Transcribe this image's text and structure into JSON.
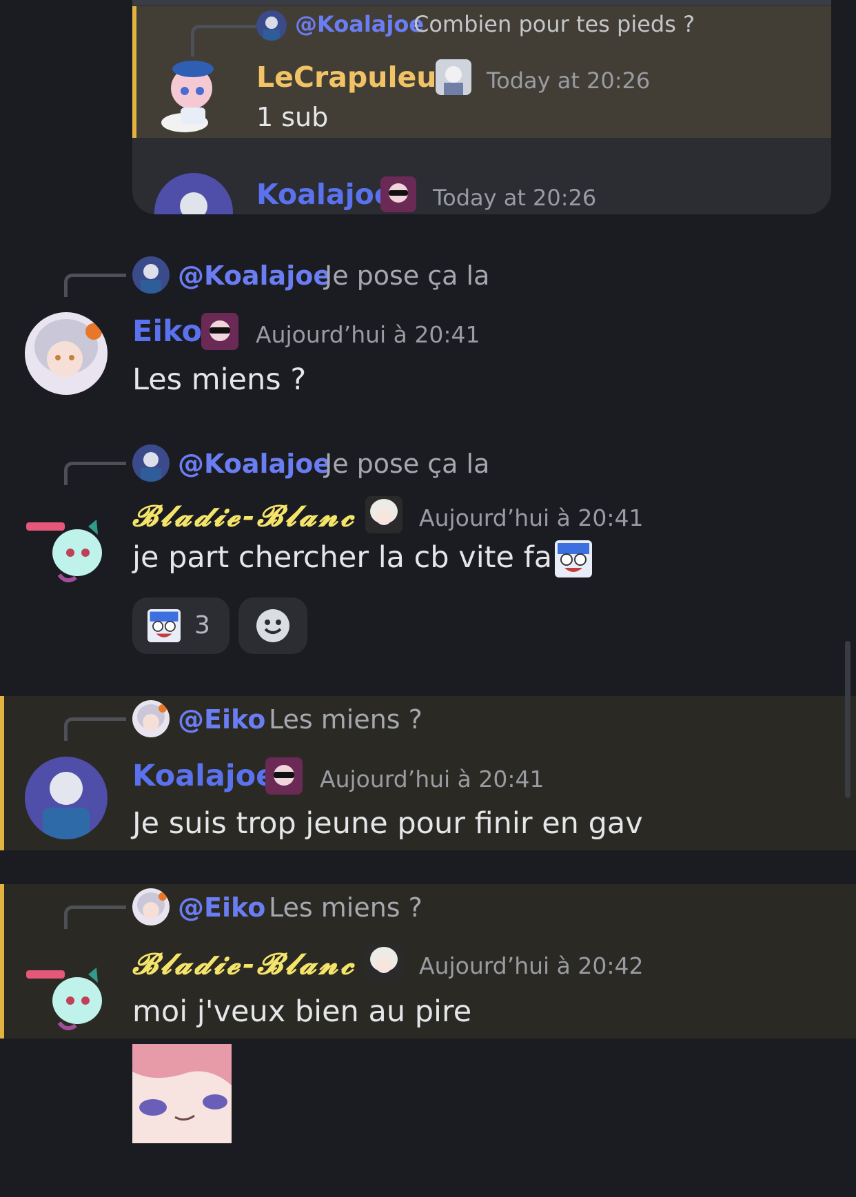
{
  "colors": {
    "background": "#1b1c21",
    "mention": "#6a7df2",
    "highlight_bar": "#e3b341",
    "timestamp": "#9a9ca3"
  },
  "embed": {
    "reply": {
      "user": "@Koalajoe",
      "text": "Combien pour tes pieds ?"
    },
    "message1": {
      "author": "LeCrapuleux",
      "timestamp": "Today at 20:26",
      "text": "1 sub"
    },
    "message2": {
      "author": "Koalajoe",
      "timestamp": "Today at 20:26"
    }
  },
  "messages": [
    {
      "reply_user": "@Koalajoe",
      "reply_text": "Je pose ça la",
      "author": "Eiko",
      "timestamp": "Aujourd’hui à 20:41",
      "text": "Les miens ?"
    },
    {
      "reply_user": "@Koalajoe",
      "reply_text": "Je pose ça la",
      "author": "Bladie-Blanc",
      "author_display": "𝓑𝓵𝓪𝓭𝓲𝓮-𝓑𝓵𝓪𝓷𝓬",
      "timestamp": "Aujourd’hui à 20:41",
      "text": "je part chercher la cb vite fait",
      "emoji": "crying-laugh-emoji",
      "reaction": {
        "emoji": "crying-laugh-emoji",
        "count": "3"
      }
    },
    {
      "reply_user": "@Eiko",
      "reply_text": "Les miens ?",
      "author": "Koalajoe",
      "timestamp": "Aujourd’hui à 20:41",
      "text": "Je suis trop jeune pour finir en gav"
    },
    {
      "reply_user": "@Eiko",
      "reply_text": "Les miens ?",
      "author": "Bladie-Blanc",
      "author_display": "𝓑𝓵𝓪𝓭𝓲𝓮-𝓑𝓵𝓪𝓷𝓬",
      "timestamp": "Aujourd’hui à 20:42",
      "text": "moi j'veux bien au pire",
      "sticker": "pink-hair-anime-sticker"
    }
  ]
}
